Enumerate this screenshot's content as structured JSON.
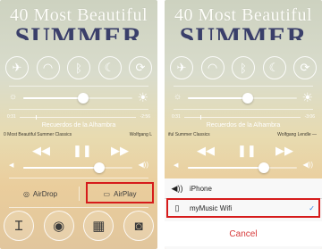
{
  "album": {
    "line1": "40 Most Beautiful",
    "line2": "SUMMER"
  },
  "toggles": [
    {
      "name": "airplane-mode-icon",
      "glyph": "✈"
    },
    {
      "name": "wifi-icon",
      "glyph": "◠"
    },
    {
      "name": "bluetooth-icon",
      "glyph": "ᛒ"
    },
    {
      "name": "do-not-disturb-icon",
      "glyph": "☾"
    },
    {
      "name": "rotation-lock-icon",
      "glyph": "⟳"
    }
  ],
  "brightness": {
    "level": 0.55
  },
  "player": {
    "elapsed": "0:31",
    "remaining_left": "-2:56",
    "remaining_right": "-3:06",
    "title": "Recuerdos de la Alhambra",
    "album_line_left": "0 Most Beautiful Summer Classics",
    "artist_left": "Wolfgang L",
    "album_line_right": "iful Summer Classics",
    "artist_right": "Wolfgang Lendle —",
    "prev_glyph": "◀◀",
    "pause_glyph": "❚❚",
    "next_glyph": "▶▶"
  },
  "volume": {
    "level": 0.7
  },
  "airdrop": {
    "label": "AirDrop"
  },
  "airplay": {
    "label": "AirPlay"
  },
  "shortcuts": [
    {
      "name": "flashlight-icon",
      "glyph": "Ɪ"
    },
    {
      "name": "timer-icon",
      "glyph": "◉"
    },
    {
      "name": "calculator-icon",
      "glyph": "▦"
    },
    {
      "name": "camera-icon",
      "glyph": "◙"
    }
  ],
  "airplay_sheet": {
    "iphone_label": "iPhone",
    "wifi_label": "myMusic Wifi",
    "checkmark": "✓",
    "cancel_label": "Cancel"
  },
  "colors": {
    "highlight": "#d61b1b",
    "cancel": "#d73a3a"
  }
}
